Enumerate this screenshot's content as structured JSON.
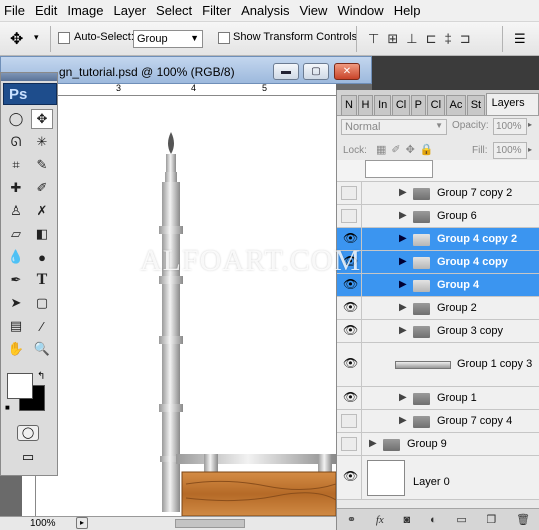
{
  "menu": [
    "File",
    "Edit",
    "Image",
    "Layer",
    "Select",
    "Filter",
    "Analysis",
    "View",
    "Window",
    "Help"
  ],
  "options": {
    "auto_select_label": "Auto-Select:",
    "auto_select_value": "Group",
    "transform_label": "Show Transform Controls"
  },
  "document": {
    "title": "gn_tutorial.psd @ 100% (RGB/8)",
    "ruler_ticks": [
      "3",
      "4",
      "5"
    ],
    "zoom": "100%"
  },
  "tools_panel": {
    "logo": "Ps"
  },
  "layers_panel": {
    "tabs": [
      "N",
      "H",
      "In",
      "Cl",
      "P",
      "Cl",
      "Ac",
      "St",
      "Layers"
    ],
    "blend_mode": "Normal",
    "opacity_label": "Opacity:",
    "opacity_value": "100%",
    "lock_label": "Lock:",
    "fill_label": "Fill:",
    "fill_value": "100%",
    "layers": [
      {
        "name": "Group 7 copy 2",
        "visible": false,
        "selected": false,
        "type": "group",
        "indent": 1
      },
      {
        "name": "Group 6",
        "visible": false,
        "selected": false,
        "type": "group",
        "indent": 1
      },
      {
        "name": "Group 4 copy 2",
        "visible": true,
        "selected": true,
        "type": "group",
        "indent": 1
      },
      {
        "name": "Group 4 copy",
        "visible": true,
        "selected": true,
        "type": "group",
        "indent": 1
      },
      {
        "name": "Group 4",
        "visible": true,
        "selected": true,
        "type": "group",
        "indent": 1
      },
      {
        "name": "Group 2",
        "visible": true,
        "selected": false,
        "type": "group",
        "indent": 1
      },
      {
        "name": "Group 3 copy",
        "visible": true,
        "selected": false,
        "type": "group",
        "indent": 1
      },
      {
        "name": "Group 1 copy 3",
        "visible": true,
        "selected": false,
        "type": "thumb",
        "indent": 1
      },
      {
        "name": "Group 1",
        "visible": true,
        "selected": false,
        "type": "group",
        "indent": 1
      },
      {
        "name": "Group 7 copy 4",
        "visible": false,
        "selected": false,
        "type": "group",
        "indent": 1
      },
      {
        "name": "Group 9",
        "visible": false,
        "selected": false,
        "type": "group",
        "indent": 0
      },
      {
        "name": "Layer 0",
        "visible": true,
        "selected": false,
        "type": "layer",
        "indent": 0
      }
    ],
    "footer_fx": "fx"
  },
  "watermark": "ALFOART.COM",
  "colors": {
    "selected": "#3b95f0",
    "ps_blue": "#1e4d8c",
    "wood": "#c0742e"
  }
}
